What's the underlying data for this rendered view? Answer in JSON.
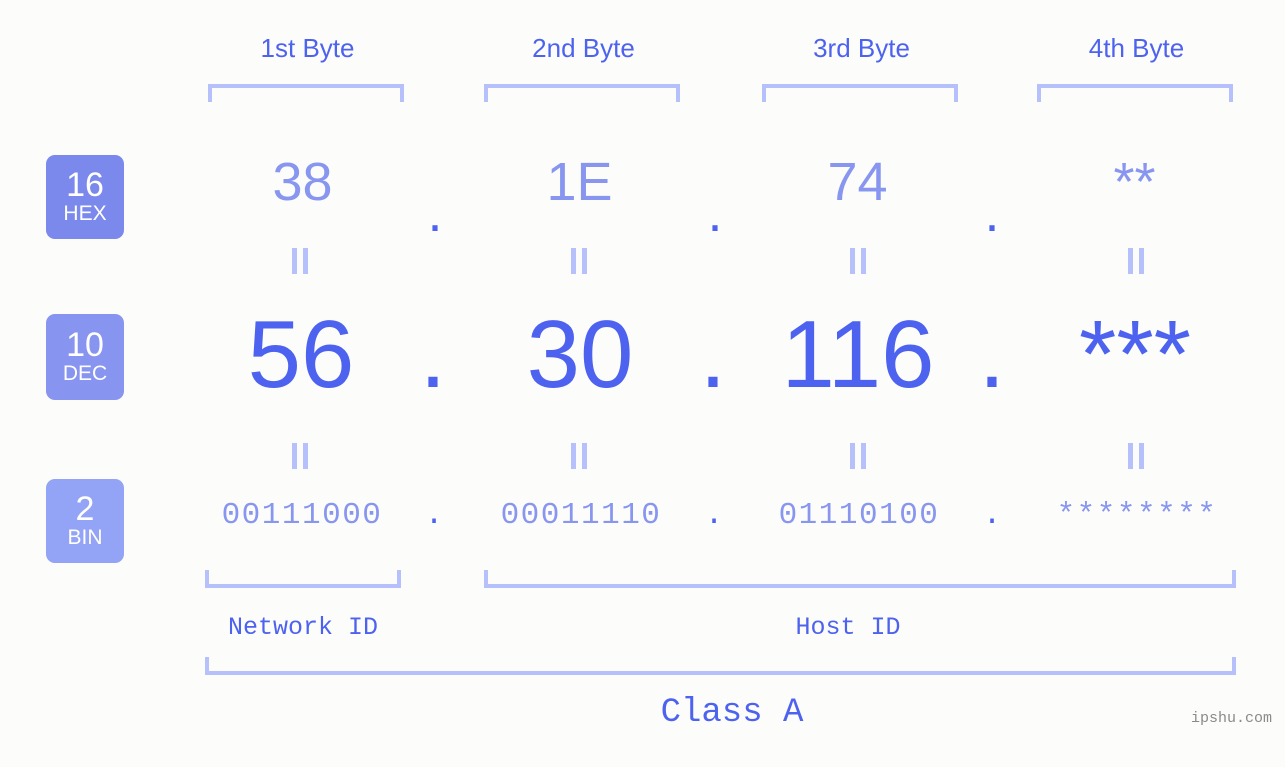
{
  "meta": {
    "watermark": "ipshu.com",
    "background_color": "#fcfdfa",
    "accent_color": "#4e62f0",
    "accent_light_color": "#8896f0",
    "bracket_color": "#b6c0fb"
  },
  "byte_headers": [
    {
      "label": "1st Byte"
    },
    {
      "label": "2nd Byte"
    },
    {
      "label": "3rd Byte"
    },
    {
      "label": "4th Byte"
    }
  ],
  "rows": [
    {
      "badge_number": "16",
      "badge_name": "HEX",
      "badge_color": "#7b88ec",
      "values": [
        "38",
        "1E",
        "74",
        "**"
      ],
      "separator": "."
    },
    {
      "badge_number": "10",
      "badge_name": "DEC",
      "badge_color": "#8794f0",
      "values": [
        "56",
        "30",
        "116",
        "***"
      ],
      "separator": "."
    },
    {
      "badge_number": "2",
      "badge_name": "BIN",
      "badge_color": "#93a3f6",
      "values": [
        "00111000",
        "00011110",
        "01110100",
        "********"
      ],
      "separator": "."
    }
  ],
  "equals_marks": {
    "symbol": "=",
    "count_per_row": 4
  },
  "sections": [
    {
      "label": "Network ID"
    },
    {
      "label": "Host ID"
    }
  ],
  "class": {
    "label": "Class A"
  }
}
